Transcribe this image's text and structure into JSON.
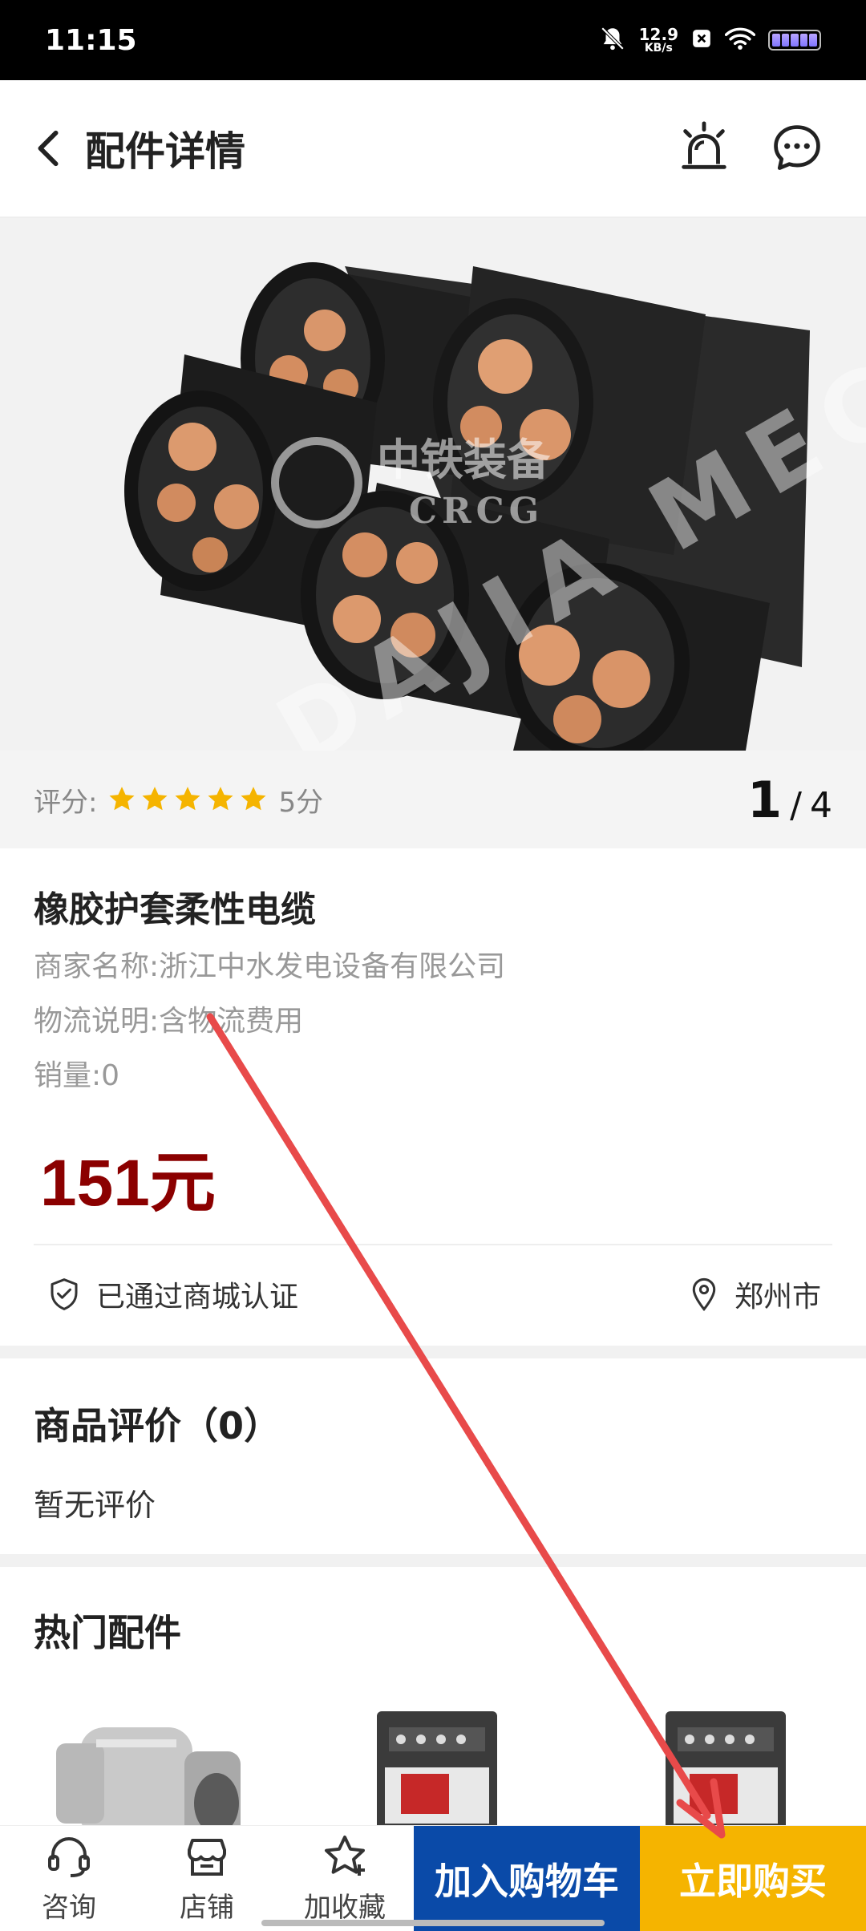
{
  "status_bar": {
    "time": "11:15",
    "net_speed_value": "12.9",
    "net_speed_unit": "KB/s",
    "icons": [
      "bell-muted-icon",
      "close-box-icon",
      "wifi-icon",
      "battery-icon"
    ]
  },
  "header": {
    "title": "配件详情",
    "back_icon": "chevron-left-icon",
    "actions": [
      "alarm-light-icon",
      "chat-bubble-icon"
    ]
  },
  "product_image": {
    "watermark_cn": "中铁装备",
    "watermark_en": "CRCG",
    "watermark_brand": "DAJIA MECH"
  },
  "rating": {
    "label": "评分:",
    "stars": 5,
    "max_stars": 5,
    "score_text": "5分"
  },
  "pager": {
    "current": "1",
    "separator": "/",
    "total": "4"
  },
  "product": {
    "name": "橡胶护套柔性电缆",
    "merchant_label": "商家名称:",
    "merchant_value": "浙江中水发电设备有限公司",
    "logistics_label": "物流说明:",
    "logistics_value": "含物流费用",
    "sales_label": "销量:",
    "sales_value": "0",
    "price": "151元",
    "certified_text": "已通过商城认证",
    "city": "郑州市"
  },
  "reviews": {
    "title": "商品评价（0）",
    "empty_text": "暂无评价"
  },
  "hot_parts": {
    "title": "热门配件"
  },
  "bottom_bar": {
    "consult_label": "咨询",
    "store_label": "店铺",
    "favorite_label": "加收藏",
    "add_cart_label": "加入购物车",
    "buy_now_label": "立即购买"
  },
  "colors": {
    "price": "#8b0000",
    "star": "#f5b400",
    "add_cart_bg": "#0a4aa8",
    "buy_now_bg": "#f5b400",
    "annotation_arrow": "#e84a4a"
  }
}
